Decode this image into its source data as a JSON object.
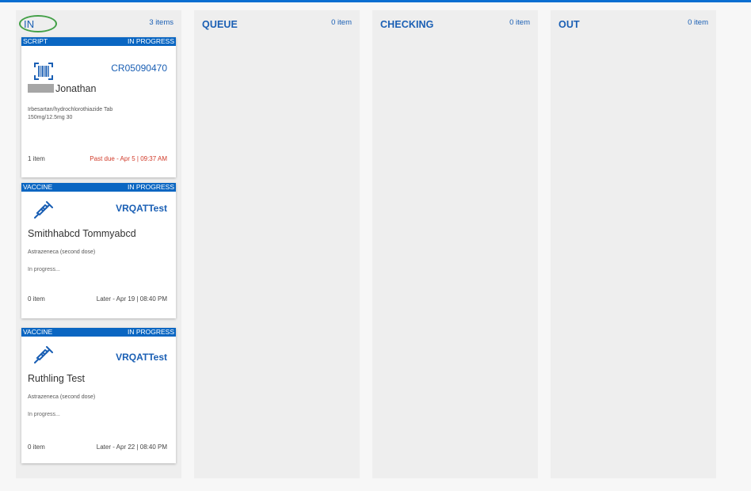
{
  "columns": [
    {
      "title": "IN",
      "count": "3 items"
    },
    {
      "title": "QUEUE",
      "count": "0 item"
    },
    {
      "title": "CHECKING",
      "count": "0 item"
    },
    {
      "title": "OUT",
      "count": "0 item"
    }
  ],
  "cards": [
    {
      "type": "SCRIPT",
      "status": "IN PROGRESS",
      "icon": "barcode-icon",
      "id": "CR05090470",
      "patient": "Jonathan",
      "drug": "Irbesartan/hydrochlorothiazide Tab 150mg/12.5mg 30",
      "progress": "",
      "items": "1 item",
      "due": "Past due - Apr 5 | 09:37 AM"
    },
    {
      "type": "VACCINE",
      "status": "IN PROGRESS",
      "icon": "syringe-icon",
      "id": "VRQATTest",
      "patient": "Smithhabcd Tommyabcd",
      "drug": "Astrazeneca (second dose)",
      "progress": "In progress...",
      "items": "0 item",
      "due": "Later - Apr 19 | 08:40 PM"
    },
    {
      "type": "VACCINE",
      "status": "IN PROGRESS",
      "icon": "syringe-icon",
      "id": "VRQATTest",
      "patient": "Ruthling Test",
      "drug": "Astrazeneca (second dose)",
      "progress": "In progress...",
      "items": "0 item",
      "due": "Later - Apr 22 | 08:40 PM"
    }
  ],
  "colors": {
    "accent": "#0a66c2",
    "overdue": "#d13b2a",
    "highlight": "#43a047"
  }
}
